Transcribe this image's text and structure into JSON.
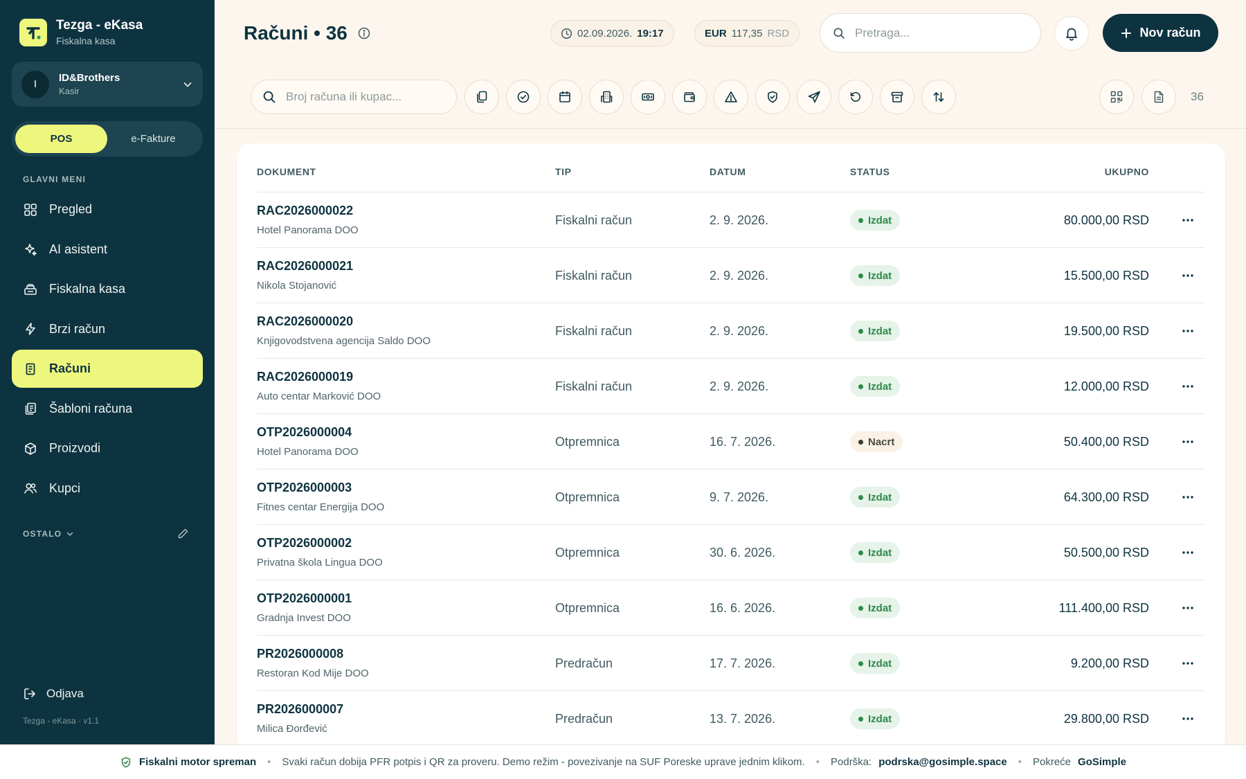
{
  "app": {
    "name": "Tezga - eKasa",
    "subtitle": "Fiskalna kasa",
    "version": "Tezga - eKasa · v1.1"
  },
  "account": {
    "initial": "I",
    "name": "ID&Brothers",
    "role": "Kasir"
  },
  "modes": [
    {
      "label": "POS",
      "active": true
    },
    {
      "label": "e-Fakture",
      "active": false
    }
  ],
  "sidebar": {
    "section_label": "GLAVNI MENI",
    "items": [
      {
        "label": "Pregled",
        "icon": "grid-icon"
      },
      {
        "label": "AI asistent",
        "icon": "sparkle-icon"
      },
      {
        "label": "Fiskalna kasa",
        "icon": "register-icon"
      },
      {
        "label": "Brzi račun",
        "icon": "bolt-icon"
      },
      {
        "label": "Računi",
        "icon": "receipt-icon",
        "active": true
      },
      {
        "label": "Šabloni računa",
        "icon": "templates-icon"
      },
      {
        "label": "Proizvodi",
        "icon": "box-icon"
      },
      {
        "label": "Kupci",
        "icon": "users-icon"
      }
    ],
    "other_label": "OSTALO",
    "logout_label": "Odjava"
  },
  "header": {
    "title": "Računi • 36",
    "date": "02.09.2026.",
    "time": "19:17",
    "currency_code": "EUR",
    "currency_value": "117,35",
    "currency_unit": "RSD",
    "search_placeholder": "Pretraga...",
    "new_button_label": "Nov račun"
  },
  "toolbar": {
    "search_placeholder": "Broj računa ili kupac...",
    "count": "36"
  },
  "table": {
    "columns": {
      "document": "DOKUMENT",
      "type": "TIP",
      "date": "DATUM",
      "status": "STATUS",
      "total": "UKUPNO"
    },
    "rows": [
      {
        "doc": "RAC2026000022",
        "customer": "Hotel Panorama DOO",
        "type": "Fiskalni račun",
        "date": "2. 9. 2026.",
        "status": "Izdat",
        "amount": "80.000,00 RSD"
      },
      {
        "doc": "RAC2026000021",
        "customer": "Nikola Stojanović",
        "type": "Fiskalni račun",
        "date": "2. 9. 2026.",
        "status": "Izdat",
        "amount": "15.500,00 RSD"
      },
      {
        "doc": "RAC2026000020",
        "customer": "Knjigovodstvena agencija Saldo DOO",
        "type": "Fiskalni račun",
        "date": "2. 9. 2026.",
        "status": "Izdat",
        "amount": "19.500,00 RSD"
      },
      {
        "doc": "RAC2026000019",
        "customer": "Auto centar Marković DOO",
        "type": "Fiskalni račun",
        "date": "2. 9. 2026.",
        "status": "Izdat",
        "amount": "12.000,00 RSD"
      },
      {
        "doc": "OTP2026000004",
        "customer": "Hotel Panorama DOO",
        "type": "Otpremnica",
        "date": "16. 7. 2026.",
        "status": "Nacrt",
        "amount": "50.400,00 RSD"
      },
      {
        "doc": "OTP2026000003",
        "customer": "Fitnes centar Energija DOO",
        "type": "Otpremnica",
        "date": "9. 7. 2026.",
        "status": "Izdat",
        "amount": "64.300,00 RSD"
      },
      {
        "doc": "OTP2026000002",
        "customer": "Privatna škola Lingua DOO",
        "type": "Otpremnica",
        "date": "30. 6. 2026.",
        "status": "Izdat",
        "amount": "50.500,00 RSD"
      },
      {
        "doc": "OTP2026000001",
        "customer": "Gradnja Invest DOO",
        "type": "Otpremnica",
        "date": "16. 6. 2026.",
        "status": "Izdat",
        "amount": "111.400,00 RSD"
      },
      {
        "doc": "PR2026000008",
        "customer": "Restoran Kod Mije DOO",
        "type": "Predračun",
        "date": "17. 7. 2026.",
        "status": "Izdat",
        "amount": "9.200,00 RSD"
      },
      {
        "doc": "PR2026000007",
        "customer": "Milica Đorđević",
        "type": "Predračun",
        "date": "13. 7. 2026.",
        "status": "Izdat",
        "amount": "29.800,00 RSD"
      }
    ]
  },
  "footer": {
    "engine_status": "Fiskalni motor spreman",
    "message": "Svaki račun dobija PFR potpis i QR za proveru. Demo režim - povezivanje na SUF Poreske uprave jednim klikom.",
    "support_label": "Podrška:",
    "support_email": "podrska@gosimple.space",
    "powered_label": "Pokreće",
    "powered_by": "GoSimple"
  },
  "colors": {
    "sidebar": "#0e3340",
    "accent": "#eef77d",
    "status_ok": "#2d8a4a"
  }
}
